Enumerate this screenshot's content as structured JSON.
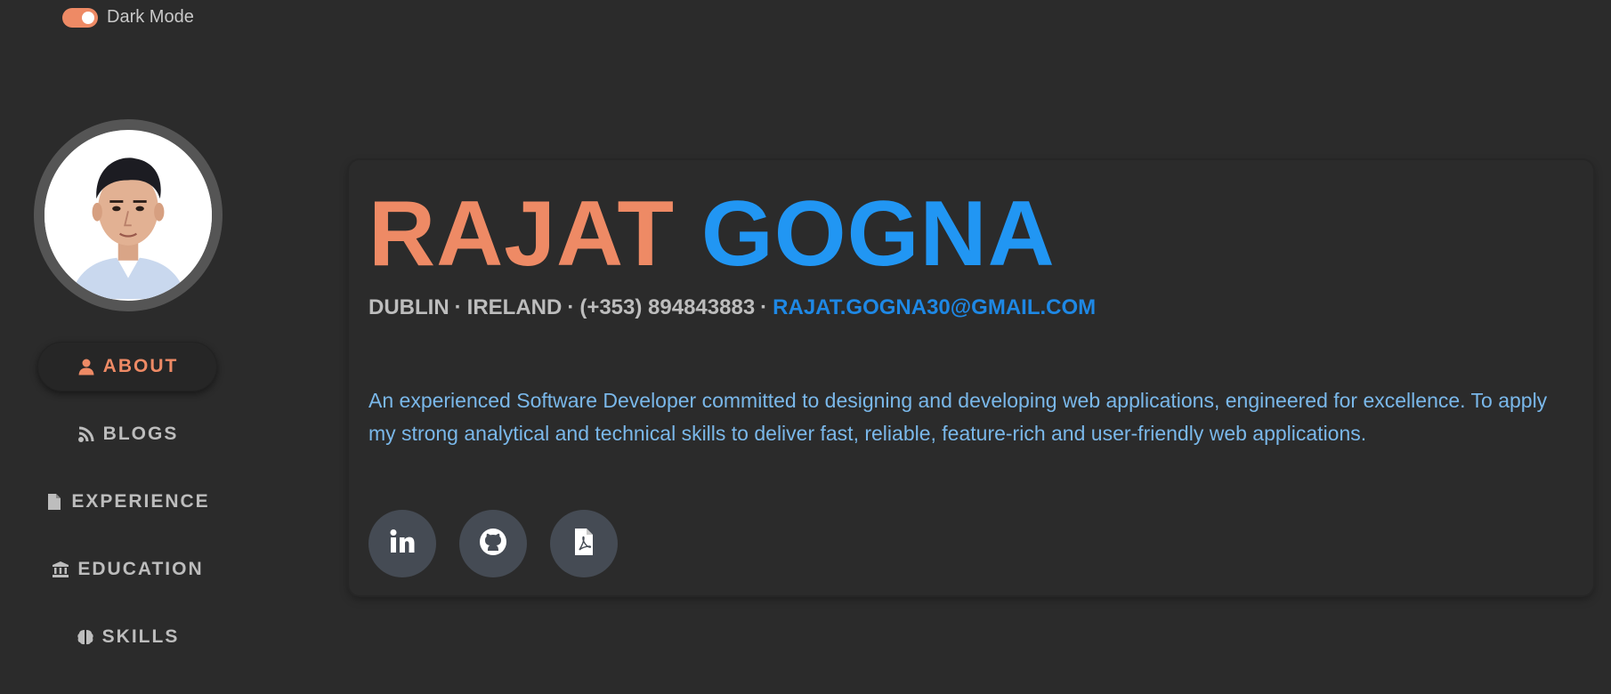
{
  "theme_toggle": {
    "label": "Dark Mode",
    "checked": true,
    "accent_color": "#ee8a65"
  },
  "sidebar": {
    "avatar_icon": "profile-photo",
    "items": [
      {
        "label": "ABOUT",
        "icon": "user-icon",
        "active": true
      },
      {
        "label": "BLOGS",
        "icon": "rss-icon",
        "active": false
      },
      {
        "label": "EXPERIENCE",
        "icon": "file-icon",
        "active": false
      },
      {
        "label": "EDUCATION",
        "icon": "university-icon",
        "active": false
      },
      {
        "label": "SKILLS",
        "icon": "brain-icon",
        "active": false
      }
    ]
  },
  "profile": {
    "first_name": "RAJAT",
    "last_name": "GOGNA",
    "city": "DUBLIN",
    "country": "IRELAND",
    "phone": "(+353) 894843883",
    "email": "RAJAT.GOGNA30@GMAIL.COM",
    "separator": "·",
    "summary": "An experienced Software Developer committed to designing and developing web applications, engineered for excellence. To apply my strong analytical and technical skills to deliver fast, reliable, feature-rich and user-friendly web applications."
  },
  "socials": [
    {
      "name": "linkedin",
      "icon": "linkedin-icon"
    },
    {
      "name": "github",
      "icon": "github-icon"
    },
    {
      "name": "resume-pdf",
      "icon": "pdf-icon"
    }
  ],
  "colors": {
    "background": "#2b2b2b",
    "accent_orange": "#ee8a65",
    "accent_blue": "#2196f3",
    "email_blue": "#1e88e5",
    "summary_blue": "#7ab8ea",
    "social_button_bg": "#454b54"
  }
}
